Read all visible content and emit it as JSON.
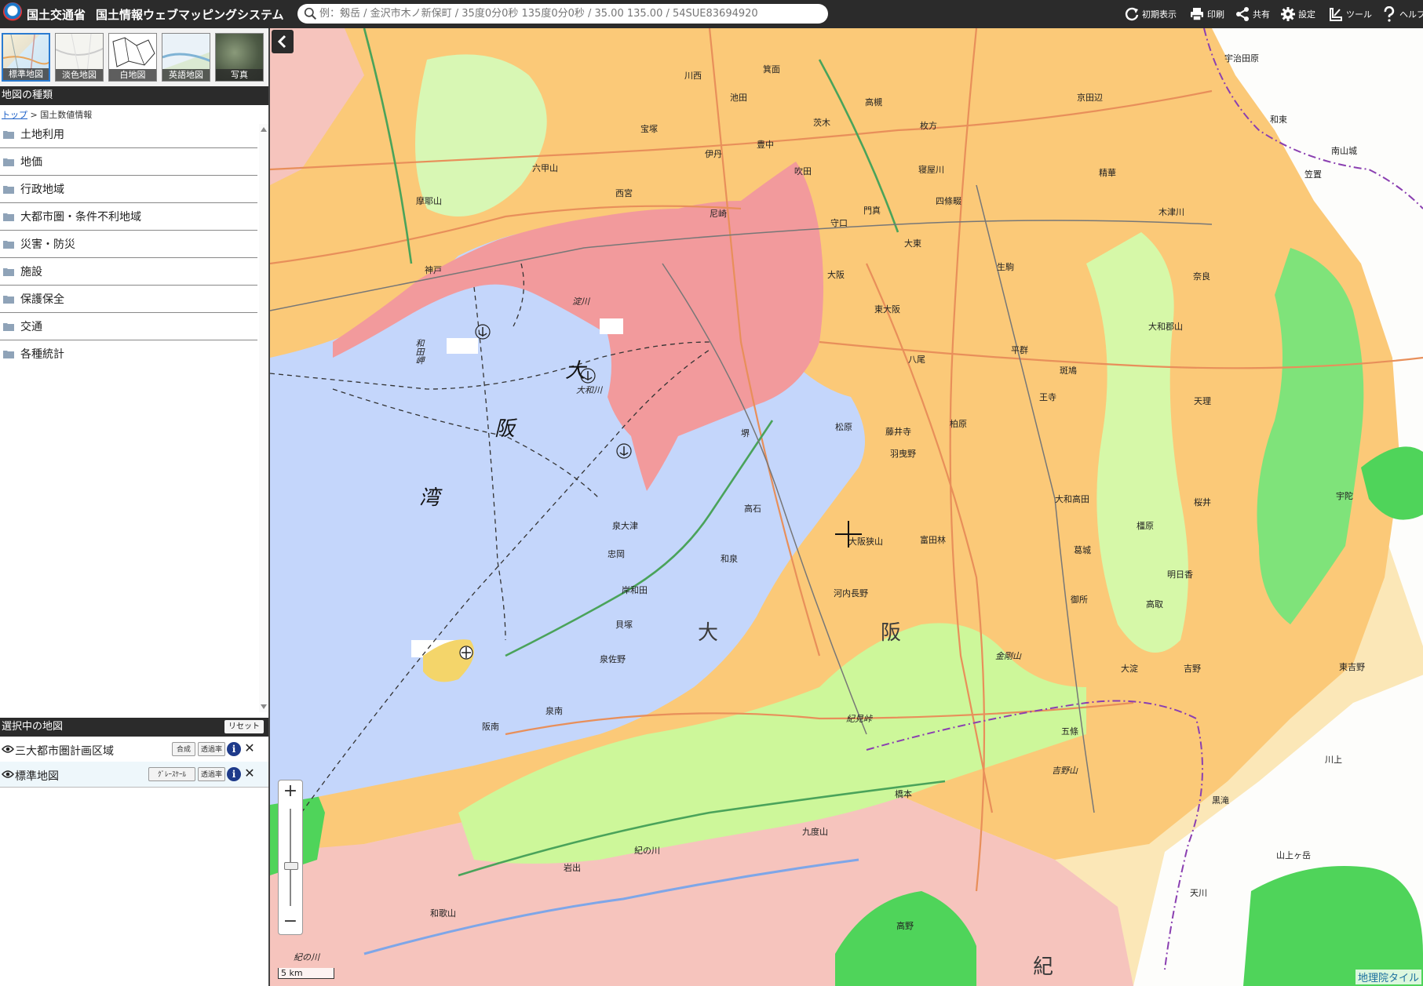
{
  "header": {
    "org": "国土交通省",
    "title": "国土情報ウェブマッピングシステム",
    "search_placeholder": "例：剱岳 / 金沢市木ノ新保町 / 35度0分0秒 135度0分0秒 / 35.00 135.00 / 54SUE83694920",
    "buttons": {
      "reset": "初期表示",
      "print": "印刷",
      "share": "共有",
      "settings": "設定",
      "tools": "ツール",
      "help": "ヘルプ"
    }
  },
  "basemaps": [
    {
      "label": "標準地図",
      "active": true
    },
    {
      "label": "淡色地図",
      "active": false
    },
    {
      "label": "白地図",
      "active": false
    },
    {
      "label": "英語地図",
      "active": false
    },
    {
      "label": "写真",
      "active": false
    }
  ],
  "map_types": {
    "title": "地図の種類",
    "breadcrumb_top": "トップ",
    "breadcrumb_sep": " > ",
    "breadcrumb_current": "国土数値情報",
    "folders": [
      "土地利用",
      "地価",
      "行政地域",
      "大都市圏・条件不利地域",
      "災害・防災",
      "施設",
      "保護保全",
      "交通",
      "各種統計"
    ]
  },
  "selected_maps": {
    "title": "選択中の地図",
    "reset_label": "リセット",
    "layers": [
      {
        "name": "三大都市圏計画区域",
        "btn1": "合成",
        "btn2": "透過率"
      },
      {
        "name": "標準地図",
        "btn1": "ｸﾞﾚｰｽｹｰﾙ",
        "btn2": "透過率"
      }
    ]
  },
  "map": {
    "scale_label": "5 km",
    "attribution": "地理院タイル",
    "labels": {
      "bay1": "大",
      "bay2": "阪",
      "bay3": "湾",
      "osaka_a": "大",
      "osaka_b": "阪",
      "ki": "紀",
      "kobe": "神戸",
      "amagasaki": "尼崎",
      "nishinomiya": "西宮",
      "osaka": "大阪",
      "higashiosaka": "東大阪",
      "sakai": "堺",
      "matsubara": "松原",
      "habikino": "羽曳野",
      "tondabayashi": "富田林",
      "kawachinagano": "河内長野",
      "osakasayama": "大阪狭山",
      "izumi": "和泉",
      "kishiwada": "岸和田",
      "kaizuka": "貝塚",
      "izumisano": "泉佐野",
      "sennan": "泉南",
      "hannan": "阪南",
      "takaishi": "高石",
      "izumiotsu": "泉大津",
      "tadaoka": "忠岡",
      "nara": "奈良",
      "yamatokoriyama": "大和郡山",
      "tenri": "天理",
      "sakurai": "桜井",
      "kashihara": "橿原",
      "yamatotakada": "大和高田",
      "katsuragi": "葛城",
      "gose": "御所",
      "asuka": "明日香",
      "takatori": "高取",
      "oyodo": "大淀",
      "yoshino": "吉野",
      "gojo": "五條",
      "hashimoto": "橋本",
      "koya": "高野",
      "kinokawa": "紀の川",
      "iwade": "岩出",
      "wakayama": "和歌山",
      "takarazuka": "宝塚",
      "itami": "伊丹",
      "toyonaka": "豊中",
      "suita": "吹田",
      "ibaraki": "茨木",
      "takatsuki": "高槻",
      "hirakata": "枚方",
      "neyagawa": "寝屋川",
      "moriguchi": "守口",
      "kadoma": "門真",
      "daito": "大東",
      "shijonawate": "四條畷",
      "yao": "八尾",
      "kashiwara": "柏原",
      "fujiidera": "藤井寺",
      "ikoma": "生駒",
      "heguri": "平群",
      "ikaruga": "斑鳩",
      "ojiuji": "王寺",
      "kyotanabe": "京田辺",
      "seika": "精華",
      "kizugawa": "木津川",
      "uji": "宇治田原",
      "wazuka": "和束",
      "minamiyamashiro": "南山城",
      "kasagi": "笠置",
      "uda": "宇陀",
      "higashiyoshino": "東吉野",
      "kawakami": "川上",
      "kurotaki": "黒滝",
      "tenkawa": "天川",
      "yamatosan": "山上ヶ岳",
      "mino": "箕面",
      "kawanishi": "川西",
      "ikeda": "池田",
      "mikage": "六甲山",
      "mayasan": "摩耶山",
      "osaka_river": "淀川",
      "yamato_river": "大和川",
      "wada": "和田岬",
      "kongo": "金剛山",
      "yoshinoyama": "吉野山",
      "kiminotoge": "紀見峠",
      "kudoyama": "九度山",
      "kinokawa_r": "紀の川",
      "sennan_road": "泉南",
      "kaizukaroad": "貝塚"
    }
  }
}
